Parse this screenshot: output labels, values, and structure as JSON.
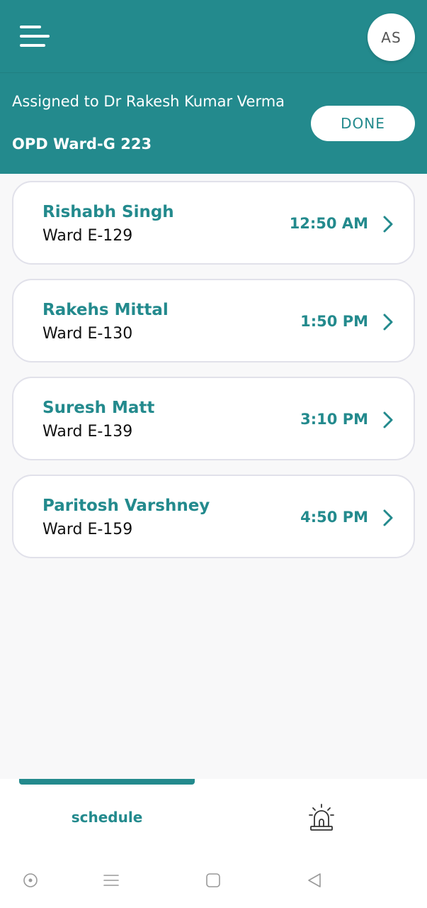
{
  "header": {
    "avatar_initials": "AS",
    "menu_icon": "hamburger-menu-icon",
    "background_color": "#238a8d"
  },
  "assignment": {
    "assigned_text": "Assigned to Dr Rakesh Kumar Verma",
    "location": "OPD Ward-G 223",
    "done_label": "DONE"
  },
  "appointments": [
    {
      "name": "Rishabh Singh",
      "ward": "Ward E-129",
      "time": "12:50 AM"
    },
    {
      "name": "Rakehs Mittal",
      "ward": "Ward E-130",
      "time": "1:50 PM"
    },
    {
      "name": "Suresh Matt",
      "ward": "Ward E-139",
      "time": "3:10 PM"
    },
    {
      "name": "Paritosh Varshney",
      "ward": "Ward E-159",
      "time": "4:50 PM"
    }
  ],
  "bottom_nav": {
    "schedule_label": "schedule",
    "emergency_icon": "siren-alarm-icon",
    "active_tab": "schedule"
  },
  "system_nav": {
    "icons": [
      "assistant-circle-icon",
      "recents-lines-icon",
      "home-square-icon",
      "back-triangle-icon"
    ]
  }
}
